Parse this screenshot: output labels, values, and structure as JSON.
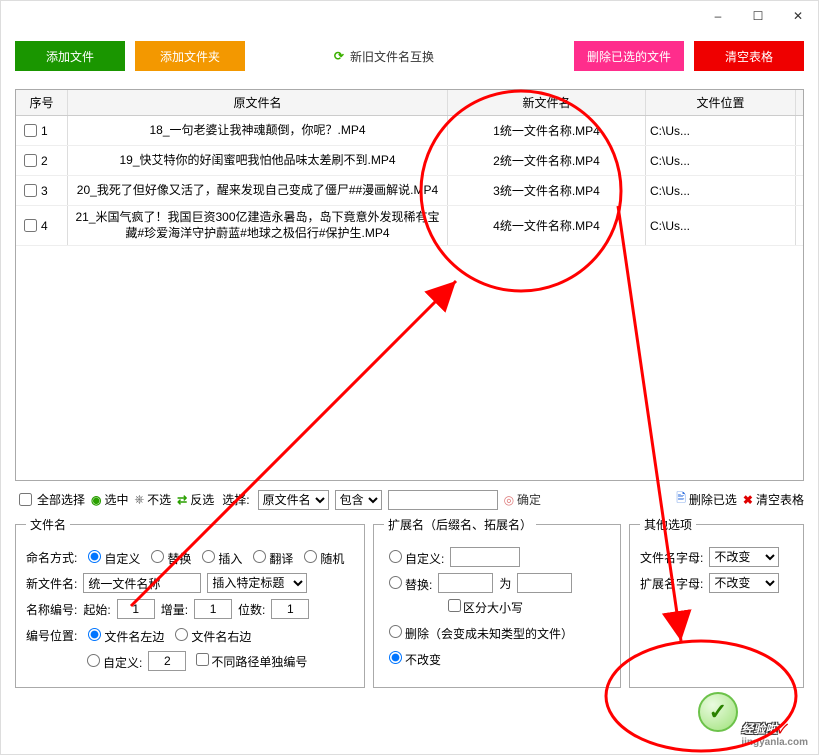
{
  "window": {
    "min": "–",
    "max": "☐",
    "close": "✕"
  },
  "toolbar": {
    "add_file": "添加文件",
    "add_folder": "添加文件夹",
    "swap": "新旧文件名互换",
    "del_selected": "删除已选的文件",
    "clear_table": "清空表格"
  },
  "grid": {
    "headers": {
      "idx": "序号",
      "orig": "原文件名",
      "new": "新文件名",
      "path": "文件位置"
    },
    "rows": [
      {
        "n": "1",
        "orig": "18_一句老婆让我神魂颠倒，你呢？.MP4",
        "new": "1统一文件名称.MP4",
        "path": "C:\\Us..."
      },
      {
        "n": "2",
        "orig": "19_快艾特你的好闺蜜吧我怕他品味太差刷不到.MP4",
        "new": "2统一文件名称.MP4",
        "path": "C:\\Us..."
      },
      {
        "n": "3",
        "orig": "20_我死了但好像又活了，醒来发现自己变成了僵尸##漫画解说.MP4",
        "new": "3统一文件名称.MP4",
        "path": "C:\\Us..."
      },
      {
        "n": "4",
        "orig": "21_米国气疯了！我国巨资300亿建造永暑岛，岛下竟意外发现稀有宝藏#珍爱海洋守护蔚蓝#地球之极侣行#保护生.MP4",
        "new": "4统一文件名称.MP4",
        "path": "C:\\Us..."
      }
    ]
  },
  "filter": {
    "select_all": "全部选择",
    "sel": "选中",
    "unsel": "不选",
    "inv": "反选",
    "choose": "选择:",
    "by_orig": "原文件名",
    "contain": "包含",
    "ok": "确定",
    "del_sel": "删除已选",
    "clear": "清空表格"
  },
  "p1": {
    "legend": "文件名",
    "mode": "命名方式:",
    "m_custom": "自定义",
    "m_replace": "替换",
    "m_insert": "插入",
    "m_trans": "翻译",
    "m_rand": "随机",
    "newname_lbl": "新文件名:",
    "newname_val": "统一文件名称",
    "insert_title": "插入特定标题",
    "num_lbl": "名称编号:",
    "start": "起始:",
    "start_v": "1",
    "step": "增量:",
    "step_v": "1",
    "digits": "位数:",
    "digits_v": "1",
    "pos_lbl": "编号位置:",
    "left": "文件名左边",
    "right": "文件名右边",
    "pos_custom": "自定义:",
    "pos_custom_v": "2",
    "diff_path": "不同路径单独编号"
  },
  "p2": {
    "legend": "扩展名（后缀名、拓展名）",
    "custom": "自定义:",
    "replace": "替换:",
    "to": "为",
    "case": "区分大小写",
    "delete": "删除（会变成未知类型的文件）",
    "nochange": "不改变"
  },
  "p3": {
    "legend": "其他选项",
    "fname_case": "文件名字母:",
    "ext_case": "扩展名字母:",
    "nochange": "不改变"
  },
  "watermark": {
    "main": "经验啦",
    "sub": "jingyanla.com"
  }
}
